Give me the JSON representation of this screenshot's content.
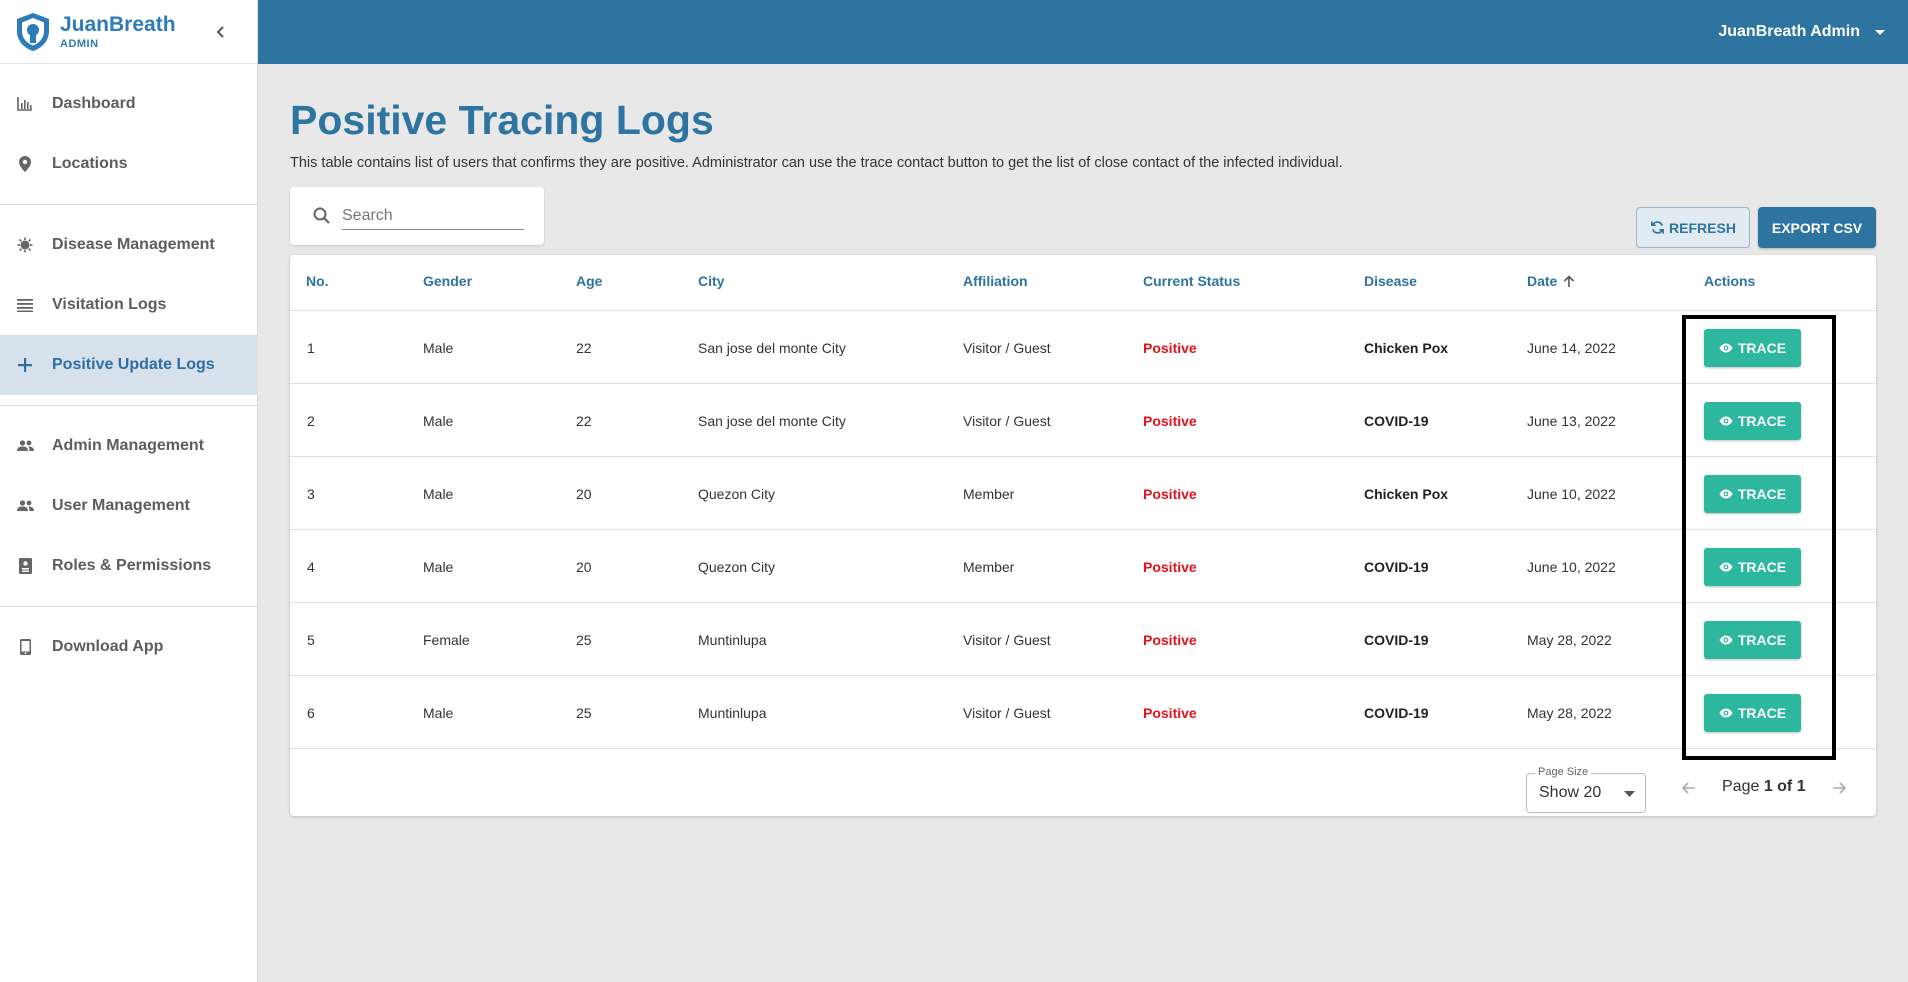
{
  "brand": {
    "name": "JuanBreath",
    "sub": "ADMIN"
  },
  "sidebar": {
    "groups": [
      [
        {
          "label": "Dashboard",
          "icon": "chart-icon"
        },
        {
          "label": "Locations",
          "icon": "pin-icon"
        }
      ],
      [
        {
          "label": "Disease Management",
          "icon": "virus-icon"
        },
        {
          "label": "Visitation Logs",
          "icon": "list-icon"
        },
        {
          "label": "Positive Update Logs",
          "icon": "plus-icon",
          "active": true
        }
      ],
      [
        {
          "label": "Admin Management",
          "icon": "people-icon"
        },
        {
          "label": "User Management",
          "icon": "people-icon"
        },
        {
          "label": "Roles & Permissions",
          "icon": "badge-icon"
        }
      ],
      [
        {
          "label": "Download App",
          "icon": "phone-icon"
        }
      ]
    ]
  },
  "topbar": {
    "admin_name": "JuanBreath Admin"
  },
  "page": {
    "title": "Positive Tracing Logs",
    "description": "This table contains list of users that confirms they are positive. Administrator can use the trace contact button to get the list of close contact of the infected individual."
  },
  "search": {
    "placeholder": "Search"
  },
  "actions": {
    "refresh_label": "REFRESH",
    "export_label": "EXPORT CSV"
  },
  "table": {
    "headers": {
      "no": "No.",
      "gender": "Gender",
      "age": "Age",
      "city": "City",
      "affiliation": "Affiliation",
      "status": "Current Status",
      "disease": "Disease",
      "date": "Date",
      "actions": "Actions"
    },
    "trace_label": "TRACE",
    "rows": [
      {
        "no": "1",
        "gender": "Male",
        "age": "22",
        "city": "San jose del monte City",
        "affiliation": "Visitor / Guest",
        "status": "Positive",
        "disease": "Chicken Pox",
        "date": "June 14, 2022"
      },
      {
        "no": "2",
        "gender": "Male",
        "age": "22",
        "city": "San jose del monte City",
        "affiliation": "Visitor / Guest",
        "status": "Positive",
        "disease": "COVID-19",
        "date": "June 13, 2022"
      },
      {
        "no": "3",
        "gender": "Male",
        "age": "20",
        "city": "Quezon City",
        "affiliation": "Member",
        "status": "Positive",
        "disease": "Chicken Pox",
        "date": "June 10, 2022"
      },
      {
        "no": "4",
        "gender": "Male",
        "age": "20",
        "city": "Quezon City",
        "affiliation": "Member",
        "status": "Positive",
        "disease": "COVID-19",
        "date": "June 10, 2022"
      },
      {
        "no": "5",
        "gender": "Female",
        "age": "25",
        "city": "Muntinlupa",
        "affiliation": "Visitor / Guest",
        "status": "Positive",
        "disease": "COVID-19",
        "date": "May 28, 2022"
      },
      {
        "no": "6",
        "gender": "Male",
        "age": "25",
        "city": "Muntinlupa",
        "affiliation": "Visitor / Guest",
        "status": "Positive",
        "disease": "COVID-19",
        "date": "May 28, 2022"
      }
    ]
  },
  "pagination": {
    "page_size_label": "Page Size",
    "page_size_value": "Show 20",
    "page_prefix": "Page ",
    "page_current": "1 of 1"
  },
  "colors": {
    "primary": "#2e74a0",
    "trace": "#2cb79e",
    "positive": "#e0121b"
  }
}
